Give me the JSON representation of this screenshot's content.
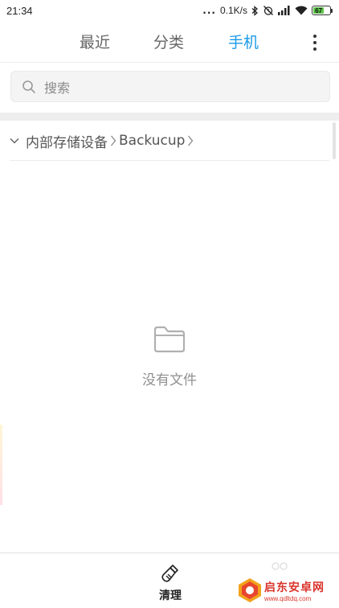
{
  "status_bar": {
    "time": "21:34",
    "dots": "...",
    "speed": "0.1K/s",
    "battery": "67",
    "battery_color": "#5cc64a"
  },
  "tabs": [
    {
      "label": "最近",
      "active": false
    },
    {
      "label": "分类",
      "active": false
    },
    {
      "label": "手机",
      "active": true
    }
  ],
  "accent_color": "#1a9be8",
  "search": {
    "placeholder": "搜索"
  },
  "breadcrumb": {
    "items": [
      "内部存储设备",
      "Backucup"
    ]
  },
  "empty": {
    "text": "没有文件"
  },
  "bottom_bar": {
    "clean_label": "清理"
  },
  "watermark": {
    "main": "启东安卓网",
    "url": "www.qdltdq.com"
  }
}
